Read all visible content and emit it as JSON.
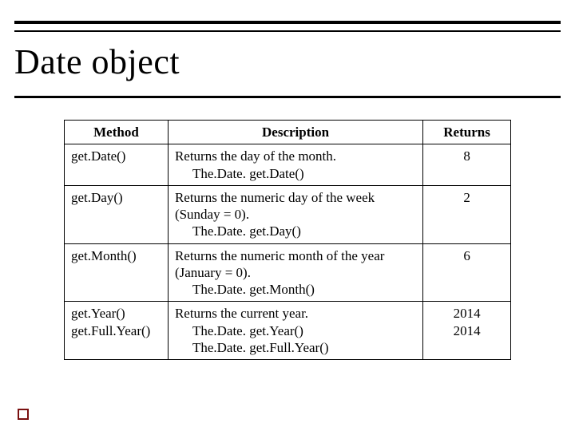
{
  "title": "Date object",
  "table": {
    "headers": {
      "method": "Method",
      "description": "Description",
      "returns": "Returns"
    },
    "rows": [
      {
        "method": "get.Date()",
        "desc_main": "Returns the day of the month.",
        "desc_subs": [
          "The.Date. get.Date()"
        ],
        "returns": [
          "8"
        ]
      },
      {
        "method": "get.Day()",
        "desc_main": "Returns the numeric day of the week (Sunday = 0).",
        "desc_subs": [
          "The.Date. get.Day()"
        ],
        "returns": [
          "2"
        ]
      },
      {
        "method": "get.Month()",
        "desc_main": "Returns the numeric month of the year (January = 0).",
        "desc_subs": [
          "The.Date. get.Month()"
        ],
        "returns": [
          "6"
        ]
      },
      {
        "method": "get.Year()\nget.Full.Year()",
        "desc_main": "Returns the current year.",
        "desc_subs": [
          "The.Date. get.Year()",
          "The.Date. get.Full.Year()"
        ],
        "returns": [
          "2014",
          "2014"
        ]
      }
    ]
  }
}
